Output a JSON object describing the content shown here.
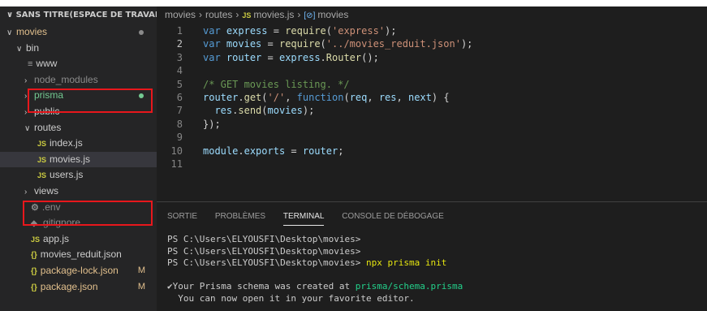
{
  "explorer": {
    "title": "SANS TITRE(ESPACE DE TRAVAIL)",
    "items": [
      {
        "label": "movies"
      },
      {
        "label": "bin"
      },
      {
        "label": "www"
      },
      {
        "label": "node_modules"
      },
      {
        "label": "prisma"
      },
      {
        "label": "public"
      },
      {
        "label": "routes"
      },
      {
        "label": "index.js"
      },
      {
        "label": "movies.js"
      },
      {
        "label": "users.js"
      },
      {
        "label": "views"
      },
      {
        "label": ".env"
      },
      {
        "label": ".gitignore"
      },
      {
        "label": "app.js"
      },
      {
        "label": "movies_reduit.json"
      },
      {
        "label": "package-lock.json",
        "badge": "M"
      },
      {
        "label": "package.json",
        "badge": "M"
      }
    ]
  },
  "breadcrumb": {
    "part1": "movies",
    "part2": "routes",
    "file_icon": "JS",
    "part3": "movies.js",
    "symbol_icon": "[⊘]",
    "part4": "movies"
  },
  "editor": {
    "active_line": 2,
    "lines": [
      {
        "n": "1",
        "t": [
          "var",
          " ",
          "express",
          " = ",
          "require",
          "(",
          "'express'",
          ");"
        ]
      },
      {
        "n": "2",
        "t": [
          "var",
          " ",
          "movies",
          " = ",
          "require",
          "(",
          "'../movies_reduit.json'",
          ");"
        ]
      },
      {
        "n": "3",
        "t": [
          "var",
          " ",
          "router",
          " = ",
          "express",
          ".",
          "Router",
          "();"
        ]
      },
      {
        "n": "4",
        "t": []
      },
      {
        "n": "5",
        "t": [
          "/* GET movies listing. */"
        ]
      },
      {
        "n": "6",
        "t": [
          "router",
          ".",
          "get",
          "(",
          "'/'",
          ", ",
          "function",
          "(",
          "req",
          ", ",
          "res",
          ", ",
          "next",
          ") {"
        ]
      },
      {
        "n": "7",
        "t": [
          "  ",
          "res",
          ".",
          "send",
          "(",
          "movies",
          ");"
        ]
      },
      {
        "n": "8",
        "t": [
          "});"
        ]
      },
      {
        "n": "9",
        "t": []
      },
      {
        "n": "10",
        "t": [
          "module",
          ".",
          "exports",
          " = ",
          "router",
          ";"
        ]
      },
      {
        "n": "11",
        "t": []
      }
    ]
  },
  "panel": {
    "tabs": [
      "SORTIE",
      "PROBLÈMES",
      "TERMINAL",
      "CONSOLE DE DÉBOGAGE"
    ],
    "active_tab": "TERMINAL"
  },
  "terminal": {
    "prompt1": "PS C:\\Users\\ELYOUSFI\\Desktop\\movies>",
    "prompt2": "PS C:\\Users\\ELYOUSFI\\Desktop\\movies>",
    "prompt3": "PS C:\\Users\\ELYOUSFI\\Desktop\\movies>",
    "command": "npx prisma init",
    "check": "✔",
    "msg1_prefix": "Your Prisma schema was created at ",
    "msg1_path": "prisma/schema.prisma",
    "msg2": "  You can now open it in your favorite editor."
  },
  "colors": {
    "highlight_box": "#e8171c",
    "git_new": "#73c991",
    "git_modified": "#e2c08d"
  }
}
